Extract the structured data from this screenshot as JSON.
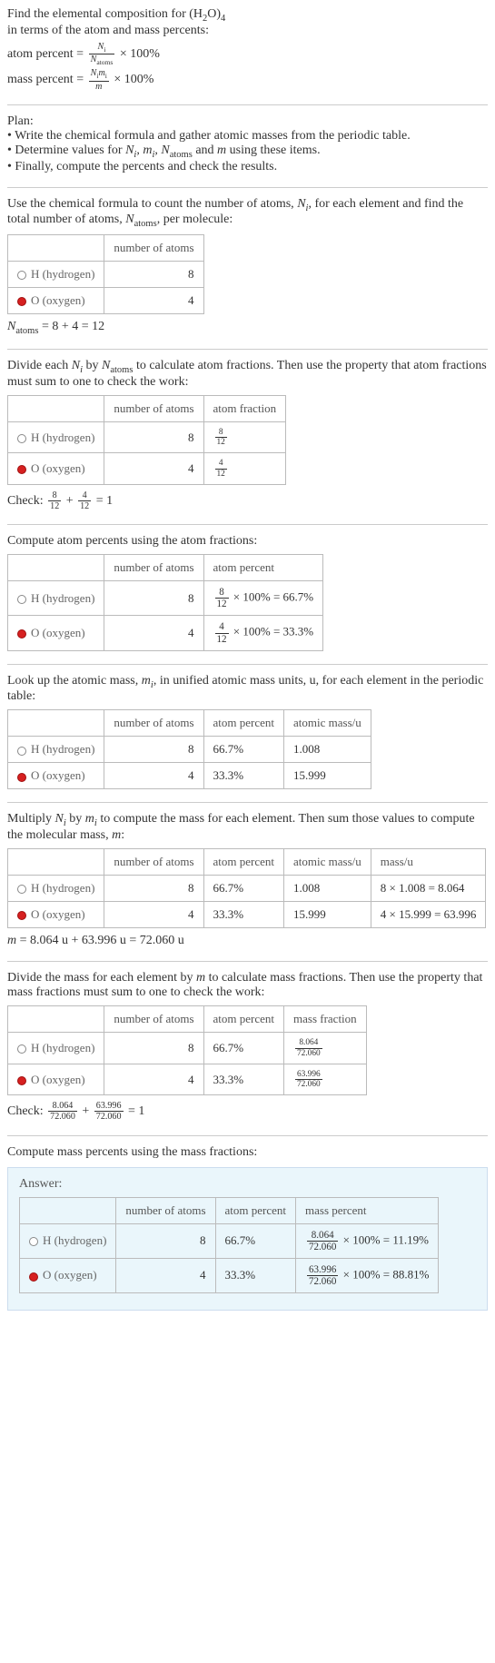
{
  "intro": {
    "line1": "Find the elemental composition for (H",
    "sub1": "2",
    "line1b": "O)",
    "sub2": "4",
    "line2": " in terms of the atom and mass percents:",
    "atom_pct_lhs": "atom percent = ",
    "atom_pct_num": "N",
    "atom_pct_num_sub": "i",
    "atom_pct_den": "N",
    "atom_pct_den_sub": "atoms",
    "times100": " × 100%",
    "mass_pct_lhs": "mass percent = ",
    "mass_pct_num1": "N",
    "mass_pct_num_sub1": "i",
    "mass_pct_num2": "m",
    "mass_pct_num_sub2": "i",
    "mass_pct_den": "m"
  },
  "plan": {
    "title": "Plan:",
    "b1": "• Write the chemical formula and gather atomic masses from the periodic table.",
    "b2a": "• Determine values for ",
    "b2b": ", ",
    "b2c": ", ",
    "b2d": " and ",
    "b2e": " using these items.",
    "N": "N",
    "i": "i",
    "m": "m",
    "atoms": "atoms",
    "b3": "• Finally, compute the percents and check the results."
  },
  "step1": {
    "text1": "Use the chemical formula to count the number of atoms, ",
    "text2": ", for each element and find the total number of atoms, ",
    "text3": ", per molecule:",
    "col_num": "number of atoms",
    "h_label": "H (hydrogen)",
    "o_label": "O (oxygen)",
    "h_n": "8",
    "o_n": "4",
    "sum_lhs": "N",
    "sum_sub": "atoms",
    "sum_rhs": " = 8 + 4 = 12"
  },
  "step2": {
    "text1": "Divide each ",
    "text2": " by ",
    "text3": " to calculate atom fractions. Then use the property that atom fractions must sum to one to check the work:",
    "col_num": "number of atoms",
    "col_frac": "atom fraction",
    "h_label": "H (hydrogen)",
    "o_label": "O (oxygen)",
    "h_n": "8",
    "h_num": "8",
    "h_den": "12",
    "o_n": "4",
    "o_num": "4",
    "o_den": "12",
    "check_pre": "Check: ",
    "plus": " + ",
    "eq1": " = 1"
  },
  "step3": {
    "text": "Compute atom percents using the atom fractions:",
    "col_num": "number of atoms",
    "col_pct": "atom percent",
    "h_label": "H (hydrogen)",
    "o_label": "O (oxygen)",
    "h_n": "8",
    "o_n": "4",
    "h_expr_num": "8",
    "h_expr_den": "12",
    "h_pct": " × 100% = 66.7%",
    "o_expr_num": "4",
    "o_expr_den": "12",
    "o_pct": " × 100% = 33.3%"
  },
  "step4": {
    "text1": "Look up the atomic mass, ",
    "text2": ", in unified atomic mass units, u, for each element in the periodic table:",
    "col_num": "number of atoms",
    "col_pct": "atom percent",
    "col_mass": "atomic mass/u",
    "h_label": "H (hydrogen)",
    "o_label": "O (oxygen)",
    "h_n": "8",
    "h_pct": "66.7%",
    "h_mass": "1.008",
    "o_n": "4",
    "o_pct": "33.3%",
    "o_mass": "15.999"
  },
  "step5": {
    "text1": "Multiply ",
    "text2": " by ",
    "text3": " to compute the mass for each element. Then sum those values to compute the molecular mass, ",
    "text4": ":",
    "col_num": "number of atoms",
    "col_pct": "atom percent",
    "col_amass": "atomic mass/u",
    "col_mass": "mass/u",
    "h_label": "H (hydrogen)",
    "o_label": "O (oxygen)",
    "h_n": "8",
    "h_pct": "66.7%",
    "h_amass": "1.008",
    "h_expr": "8 × 1.008 = 8.064",
    "o_n": "4",
    "o_pct": "33.3%",
    "o_amass": "15.999",
    "o_expr": "4 × 15.999 = 63.996",
    "sum": " = 8.064 u + 63.996 u = 72.060 u",
    "m": "m"
  },
  "step6": {
    "text1": "Divide the mass for each element by ",
    "text2": " to calculate mass fractions. Then use the property that mass fractions must sum to one to check the work:",
    "col_num": "number of atoms",
    "col_pct": "atom percent",
    "col_mf": "mass fraction",
    "h_label": "H (hydrogen)",
    "o_label": "O (oxygen)",
    "h_n": "8",
    "h_pct": "66.7%",
    "h_num": "8.064",
    "h_den": "72.060",
    "o_n": "4",
    "o_pct": "33.3%",
    "o_num": "63.996",
    "o_den": "72.060",
    "check_pre": "Check: ",
    "plus": " + ",
    "eq1": " = 1"
  },
  "step7": {
    "text": "Compute mass percents using the mass fractions:"
  },
  "answer": {
    "label": "Answer:",
    "col_num": "number of atoms",
    "col_apct": "atom percent",
    "col_mpct": "mass percent",
    "h_label": "H (hydrogen)",
    "o_label": "O (oxygen)",
    "h_n": "8",
    "h_apct": "66.7%",
    "h_num": "8.064",
    "h_den": "72.060",
    "h_res": " × 100% = 11.19%",
    "o_n": "4",
    "o_apct": "33.3%",
    "o_num": "63.996",
    "o_den": "72.060",
    "o_res": " × 100% = 88.81%"
  }
}
